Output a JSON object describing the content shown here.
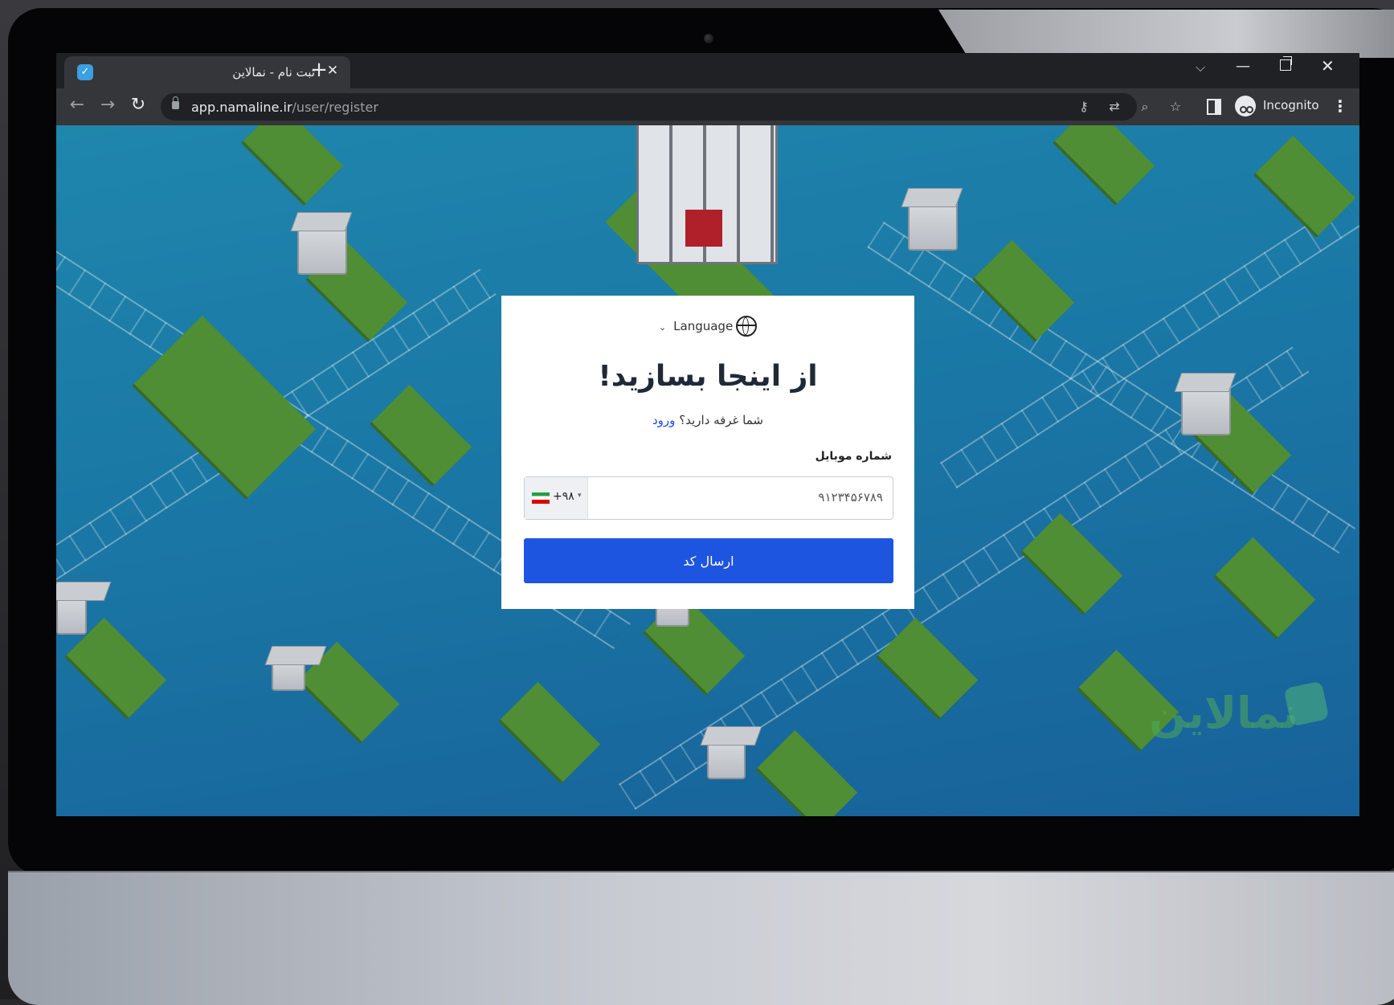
{
  "tab": {
    "title": "ثبت نام - نمالاین",
    "close": "✕",
    "new_tab": "+"
  },
  "window_controls": {
    "tab_search": "⌵",
    "minimize": "—",
    "close": "✕"
  },
  "toolbar": {
    "back": "←",
    "forward": "→",
    "reload": "↻",
    "url_host": "app.namaline.ir",
    "url_path": "/user/register",
    "incognito_label": "Incognito",
    "menu": "⋮",
    "icons": [
      "key-icon",
      "translate-icon",
      "zoom-icon",
      "star-icon",
      "side-panel-icon",
      "incognito-icon"
    ]
  },
  "icon_glyphs": {
    "key": "⚷",
    "translate": "⇄",
    "zoom": "⌕",
    "star": "☆"
  },
  "card": {
    "language_label": "Language",
    "language_chevron": "⌄",
    "heading": "از اینجا بسازید!",
    "subline_text": "شما غرفه دارید؟",
    "login_link": "ورود",
    "mobile_label": "شماره موبایل",
    "country_code": "+۹۸",
    "country_caret": "▾",
    "phone_placeholder": "۹۱۲۳۴۵۶۷۸۹",
    "submit_label": "ارسال کد"
  },
  "background": {
    "watermark_text": "نمالاین"
  },
  "colors": {
    "accent": "#1d55e0",
    "link": "#1d4ed8",
    "page_bg": "#1f86ac",
    "tile_green": "#4f8e34"
  }
}
